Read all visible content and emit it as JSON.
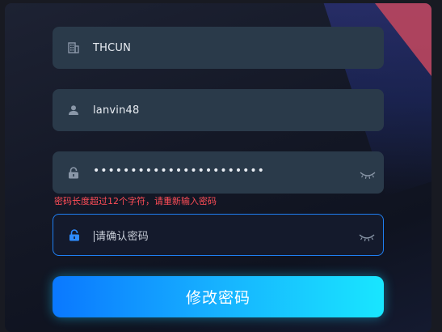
{
  "form": {
    "company": {
      "value": "THCUN",
      "icon": "building-icon"
    },
    "username": {
      "value": "lanvin48",
      "icon": "user-icon"
    },
    "password": {
      "value": "•••••••••••••••••••••••",
      "icon": "lock-icon",
      "toggle_icon": "eye-closed-icon"
    },
    "error_message": "密码长度超过12个字符，请重新输入密码",
    "confirm_password": {
      "placeholder": "请确认密码",
      "icon": "lock-icon",
      "toggle_icon": "eye-closed-icon"
    },
    "submit_label": "修改密码"
  },
  "colors": {
    "field_bg": "#2a3a4a",
    "focus_border": "#1f7ff2",
    "error": "#ff4d57",
    "button_gradient_start": "#0a78ff",
    "button_gradient_end": "#18e6ff",
    "corner_accent": "#c6485e"
  }
}
